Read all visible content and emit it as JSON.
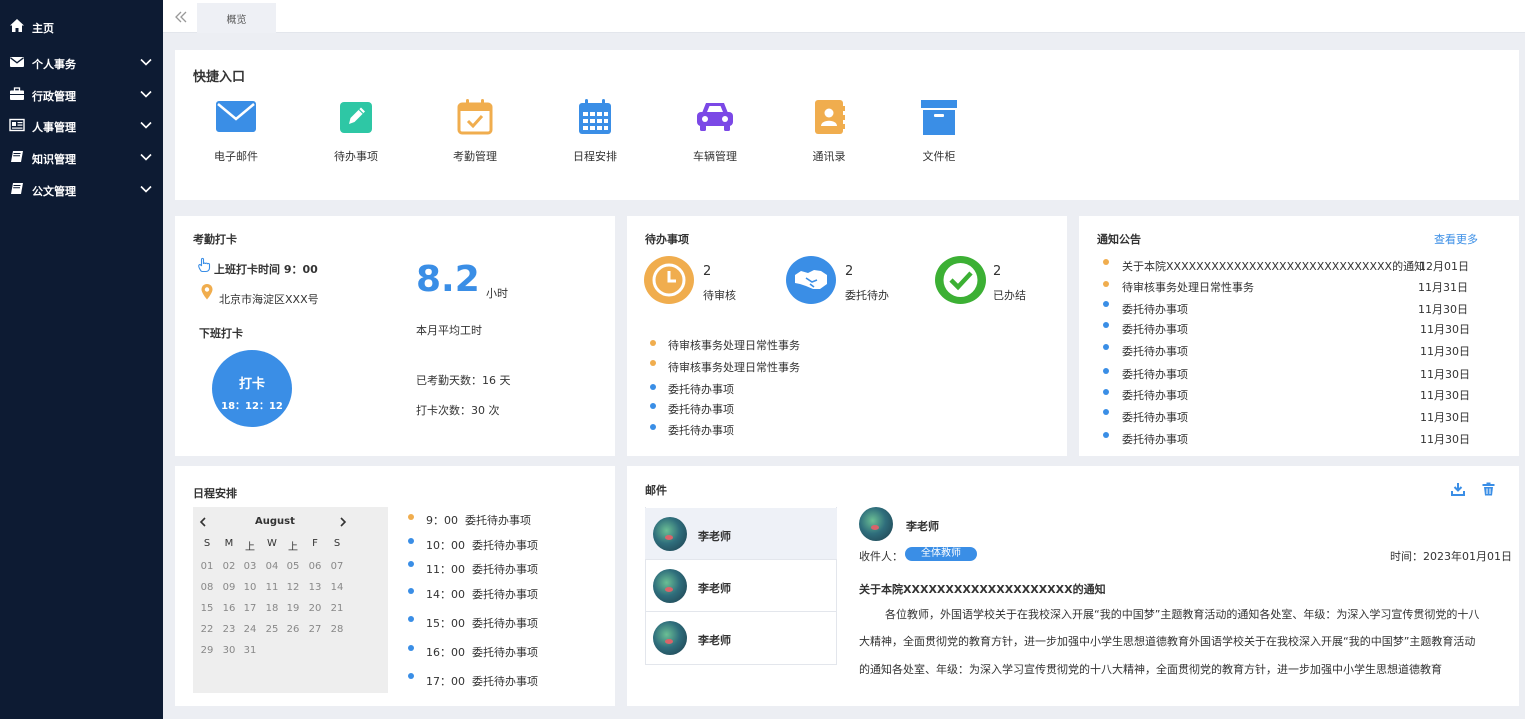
{
  "sidebar": {
    "items": [
      {
        "label": "主页",
        "icon": "home-icon"
      },
      {
        "label": "个人事务",
        "icon": "envelope-icon"
      },
      {
        "label": "行政管理",
        "icon": "briefcase-icon"
      },
      {
        "label": "人事管理",
        "icon": "id-card-icon"
      },
      {
        "label": "知识管理",
        "icon": "book-icon"
      },
      {
        "label": "公文管理",
        "icon": "book-icon"
      }
    ]
  },
  "topbar": {
    "tab_label": "概览"
  },
  "quick_entry": {
    "title": "快捷入口",
    "items": [
      {
        "label": "电子邮件",
        "icon": "mail-icon",
        "color": "#3a8ee6"
      },
      {
        "label": "待办事项",
        "icon": "edit-icon",
        "color": "#2ec7a5"
      },
      {
        "label": "考勤管理",
        "icon": "calendar-check-icon",
        "color": "#f0ad4e"
      },
      {
        "label": "日程安排",
        "icon": "calendar-icon",
        "color": "#3a8ee6"
      },
      {
        "label": "车辆管理",
        "icon": "car-icon",
        "color": "#7b48e6"
      },
      {
        "label": "通讯录",
        "icon": "address-book-icon",
        "color": "#f0ad4e"
      },
      {
        "label": "文件柜",
        "icon": "archive-icon",
        "color": "#3a8ee6"
      }
    ]
  },
  "attendance": {
    "title": "考勤打卡",
    "checkin_time": "上班打卡时间 9：00",
    "address": "北京市海淀区XXX号",
    "checkout_title": "下班打卡",
    "button_label": "打卡",
    "button_time": "18：12：12",
    "avg_hours": "8.2",
    "hours_unit": "小时",
    "avg_label": "本月平均工时",
    "days_label": "已考勤天数：16 天",
    "count_label": "打卡次数：30 次"
  },
  "todo": {
    "title": "待办事项",
    "stats": [
      {
        "count": "2",
        "label": "待审核",
        "color": "#f0ad4e"
      },
      {
        "count": "2",
        "label": "委托待办",
        "color": "#3a8ee6"
      },
      {
        "count": "2",
        "label": "已办结",
        "color": "#3cb034"
      }
    ],
    "items": [
      {
        "text": "待审核事务处理日常性事务",
        "color": "orange"
      },
      {
        "text": "待审核事务处理日常性事务",
        "color": "orange"
      },
      {
        "text": "委托待办事项",
        "color": "blue"
      },
      {
        "text": "委托待办事项",
        "color": "blue"
      },
      {
        "text": "委托待办事项",
        "color": "blue"
      }
    ]
  },
  "notice": {
    "title": "通知公告",
    "more_label": "查看更多",
    "items": [
      {
        "text": "关于本院XXXXXXXXXXXXXXXXXXXXXXXXXXXXXX的通知",
        "date": "12月01日",
        "color": "orange"
      },
      {
        "text": "待审核事务处理日常性事务",
        "date": "11月31日",
        "color": "orange"
      },
      {
        "text": "委托待办事项",
        "date": "11月30日",
        "color": "blue"
      },
      {
        "text": "委托待办事项",
        "date": "11月30日",
        "color": "blue"
      },
      {
        "text": "委托待办事项",
        "date": "11月30日",
        "color": "blue"
      },
      {
        "text": "委托待办事项",
        "date": "11月30日",
        "color": "blue"
      },
      {
        "text": "委托待办事项",
        "date": "11月30日",
        "color": "blue"
      },
      {
        "text": "委托待办事项",
        "date": "11月30日",
        "color": "blue"
      },
      {
        "text": "委托待办事项",
        "date": "11月30日",
        "color": "blue"
      }
    ]
  },
  "schedule": {
    "title": "日程安排",
    "calendar": {
      "month": "August",
      "weekdays": [
        "S",
        "M",
        "上",
        "W",
        "上",
        "F",
        "S"
      ],
      "days": [
        "01",
        "02",
        "03",
        "04",
        "05",
        "06",
        "07",
        "08",
        "09",
        "10",
        "11",
        "12",
        "13",
        "14",
        "15",
        "16",
        "17",
        "18",
        "19",
        "20",
        "21",
        "22",
        "23",
        "24",
        "25",
        "26",
        "27",
        "28",
        "29",
        "30",
        "31"
      ]
    },
    "events": [
      {
        "time": "9：00",
        "text": "委托待办事项",
        "color": "orange"
      },
      {
        "time": "10：00",
        "text": "委托待办事项",
        "color": "blue"
      },
      {
        "time": "11：00",
        "text": "委托待办事项",
        "color": "blue"
      },
      {
        "time": "14：00",
        "text": "委托待办事项",
        "color": "blue"
      },
      {
        "time": "15：00",
        "text": "委托待办事项",
        "color": "blue"
      },
      {
        "time": "16：00",
        "text": "委托待办事项",
        "color": "blue"
      },
      {
        "time": "17：00",
        "text": "委托待办事项",
        "color": "blue"
      }
    ]
  },
  "mail": {
    "title": "邮件",
    "list": [
      {
        "name": "李老师"
      },
      {
        "name": "李老师"
      },
      {
        "name": "李老师"
      }
    ],
    "detail": {
      "sender": "李老师",
      "recipient_label": "收件人：",
      "recipient_badge": "全体教师",
      "time_label": "时间：2023年01月01日",
      "subject": "关于本院XXXXXXXXXXXXXXXXXXXX的通知",
      "body_lines": [
        "各位教师，外国语学校关于在我校深入开展“我的中国梦”主题教育活动的通知各处室、年级：为深入学习宣传贯彻党的十八",
        "大精神，全面贯彻党的教育方针，进一步加强中小学生思想道德教育外国语学校关于在我校深入开展“我的中国梦”主题教育活动",
        "的通知各处室、年级：为深入学习宣传贯彻党的十八大精神，全面贯彻党的教育方针，进一步加强中小学生思想道德教育"
      ]
    }
  }
}
